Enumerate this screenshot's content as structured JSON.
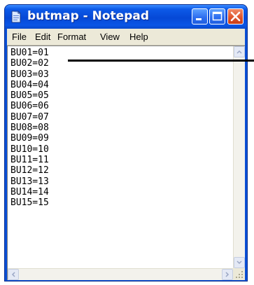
{
  "window": {
    "title": "butmap - Notepad"
  },
  "menu": [
    "File",
    "Edit",
    "Format",
    "View",
    "Help"
  ],
  "content": {
    "lines": [
      "BU01=01",
      "BU02=02",
      "BU03=03",
      "BU04=04",
      "BU05=05",
      "BU06=06",
      "BU07=07",
      "BU08=08",
      "BU09=09",
      "BU10=10",
      "BU11=11",
      "BU12=12",
      "BU13=13",
      "BU14=14",
      "BU15=15"
    ]
  },
  "icons": {
    "app": "notepad-icon",
    "minimize": "minimize-icon",
    "maximize": "maximize-icon",
    "close": "close-icon"
  },
  "colors": {
    "titlebar": "#0a4fd6",
    "close_button": "#e0552e",
    "menubar": "#ece9d8"
  }
}
